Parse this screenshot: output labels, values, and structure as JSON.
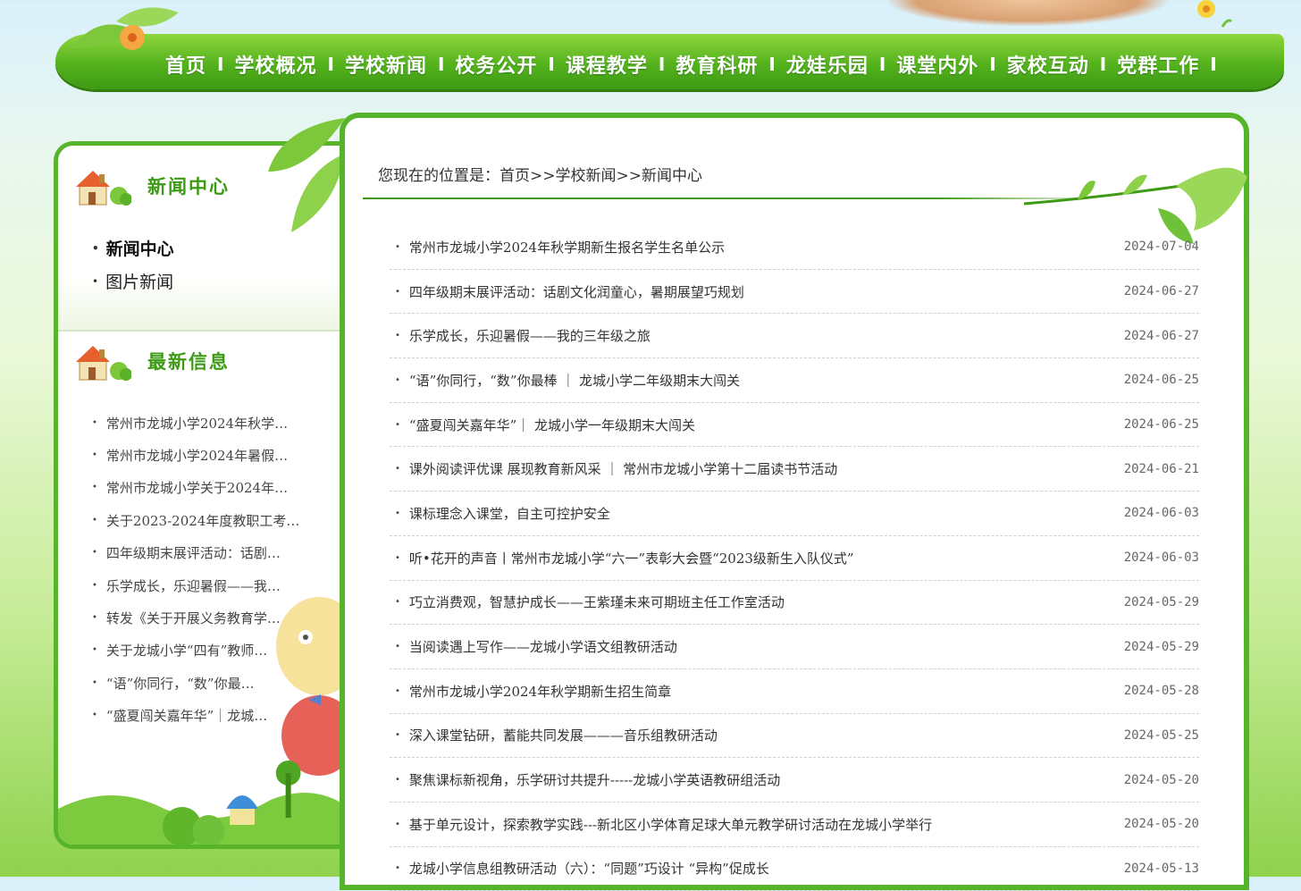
{
  "nav": {
    "items": [
      "首页",
      "学校概况",
      "学校新闻",
      "校务公开",
      "课程教学",
      "教育科研",
      "龙娃乐园",
      "课堂内外",
      "家校互动",
      "党群工作"
    ],
    "separator": "I"
  },
  "sidebar": {
    "news_center": {
      "title": "新闻中心",
      "items": [
        {
          "label": "新闻中心",
          "active": true
        },
        {
          "label": "图片新闻",
          "active": false
        }
      ]
    },
    "latest": {
      "title": "最新信息",
      "items": [
        "常州市龙城小学2024年秋学…",
        "常州市龙城小学2024年暑假…",
        "常州市龙城小学关于2024年…",
        "关于2023-2024年度教职工考…",
        "四年级期末展评活动：话剧…",
        "乐学成长，乐迎暑假——我…",
        "转发《关于开展义务教育学…",
        "关于龙城小学“四有”教师…",
        "“语”你同行，“数”你最…",
        "“盛夏闯关嘉年华”｜龙城…"
      ]
    }
  },
  "main": {
    "breadcrumb": "您现在的位置是：首页>>学校新闻>>新闻中心",
    "news": [
      {
        "title": "常州市龙城小学2024年秋学期新生报名学生名单公示",
        "date": "2024-07-04"
      },
      {
        "title": "四年级期末展评活动：话剧文化润童心，暑期展望巧规划",
        "date": "2024-06-27"
      },
      {
        "title": "乐学成长，乐迎暑假——我的三年级之旅",
        "date": "2024-06-27"
      },
      {
        "title": "“语”你同行，“数”你最棒 ｜ 龙城小学二年级期末大闯关",
        "date": "2024-06-25"
      },
      {
        "title": "“盛夏闯关嘉年华”｜ 龙城小学一年级期末大闯关",
        "date": "2024-06-25"
      },
      {
        "title": "课外阅读评优课 展现教育新风采 ｜ 常州市龙城小学第十二届读书节活动",
        "date": "2024-06-21"
      },
      {
        "title": "课标理念入课堂，自主可控护安全",
        "date": "2024-06-03"
      },
      {
        "title": "听•花开的声音丨常州市龙城小学“六一”表彰大会暨“2023级新生入队仪式”",
        "date": "2024-06-03"
      },
      {
        "title": "巧立消费观，智慧护成长——王紫瑾未来可期班主任工作室活动",
        "date": "2024-05-29"
      },
      {
        "title": "当阅读遇上写作——龙城小学语文组教研活动",
        "date": "2024-05-29"
      },
      {
        "title": "常州市龙城小学2024年秋学期新生招生简章",
        "date": "2024-05-28"
      },
      {
        "title": "深入课堂钻研，蓄能共同发展———音乐组教研活动",
        "date": "2024-05-25"
      },
      {
        "title": "聚焦课标新视角，乐学研讨共提升-----龙城小学英语教研组活动",
        "date": "2024-05-20"
      },
      {
        "title": "基于单元设计，探索教学实践---新北区小学体育足球大单元教学研讨活动在龙城小学举行",
        "date": "2024-05-20"
      },
      {
        "title": "龙城小学信息组教研活动（六）：“同题”巧设计 “异构”促成长",
        "date": "2024-05-13"
      }
    ]
  },
  "colors": {
    "brand_green": "#56b42a",
    "title_green": "#3d9a14",
    "nav_text": "#ffffff"
  },
  "icons": [
    "house-icon",
    "leaf-icon",
    "flower-icon",
    "mascot-icon",
    "bullet-dot-icon"
  ]
}
